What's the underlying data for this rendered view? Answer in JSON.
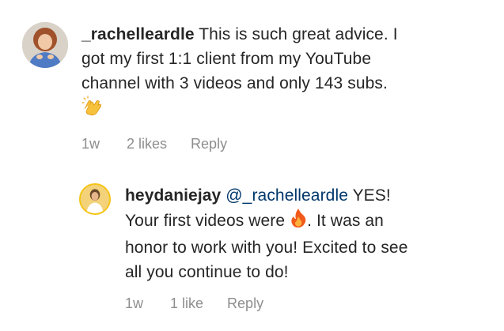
{
  "comments": [
    {
      "username": "_rachelleardle",
      "text_line_1": "This is such great advice. I",
      "text_line_2": "got my first 1:1 client from my YouTube",
      "text_line_3": "channel with 3 videos and only 143 subs.",
      "emoji": "clapping-hands",
      "time": "1w",
      "likes": "2 likes",
      "reply_label": "Reply"
    }
  ],
  "reply": {
    "username": "heydaniejay",
    "mention": "@_rachelleardle",
    "text_part_1": "YES!",
    "text_part_2": "Your first videos were",
    "emoji": "fire",
    "text_part_3": ". It was an",
    "text_part_4": "honor to work with you! Excited to see",
    "text_part_5": "all you continue to do!",
    "time": "1w",
    "likes": "1 like",
    "reply_label": "Reply"
  },
  "colors": {
    "text": "#262626",
    "meta": "#8e8e8e",
    "mention": "#00376b"
  }
}
